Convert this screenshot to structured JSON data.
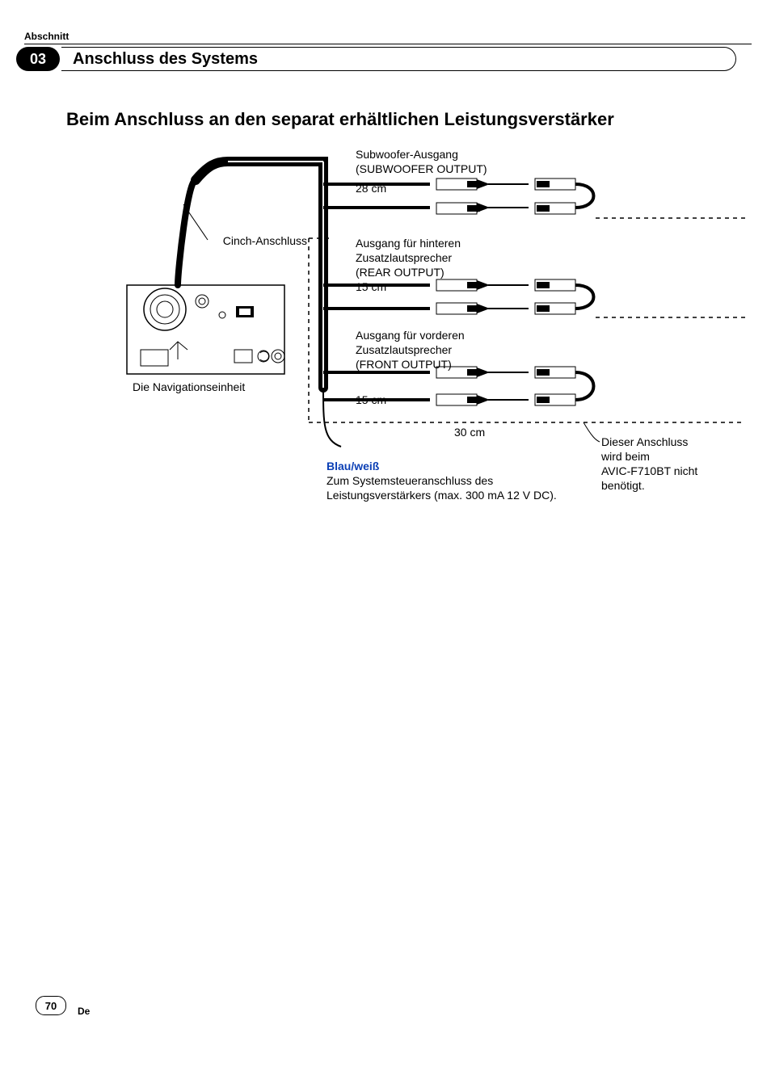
{
  "header": {
    "abschnitt": "Abschnitt",
    "section_number": "03",
    "section_title": "Anschluss des Systems"
  },
  "main": {
    "heading": "Beim Anschluss an den separat erhältlichen Leistungsverstärker"
  },
  "labels": {
    "nav_unit": "Die Navigationseinheit",
    "cinch": "Cinch-Anschluss",
    "sub_title": "Subwoofer-Ausgang",
    "sub_sub": "(SUBWOOFER OUTPUT)",
    "len_28": "28 cm",
    "rear_l1": "Ausgang für hinteren",
    "rear_l2": "Zusatzlautsprecher",
    "rear_l3": "(REAR OUTPUT)",
    "len_15": "15 cm",
    "front_l1": "Ausgang für vorderen",
    "front_l2": "Zusatzlautsprecher",
    "front_l3": "(FRONT OUTPUT)",
    "len_30": "30 cm",
    "blue_white": "Blau/weiß",
    "sys_ctrl_l1": "Zum Systemsteueranschluss des",
    "sys_ctrl_l2": "Leistungsverstärkers (max. 300 mA 12 V DC).",
    "not_needed_l1": "Dieser Anschluss",
    "not_needed_l2": "wird beim",
    "not_needed_l3": "AVIC-F710BT nicht",
    "not_needed_l4": "benötigt."
  },
  "footer": {
    "page": "70",
    "lang": "De"
  }
}
